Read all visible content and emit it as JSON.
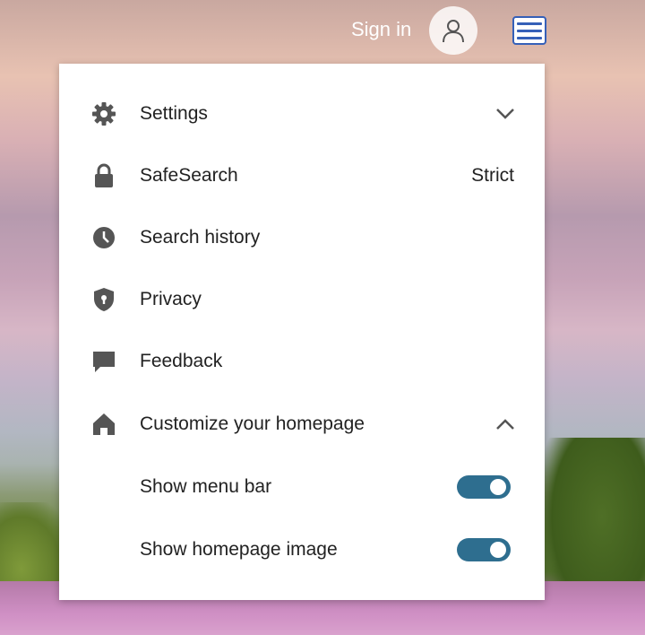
{
  "header": {
    "sign_in_label": "Sign in"
  },
  "menu": {
    "items": [
      {
        "label": "Settings",
        "icon": "gear-icon",
        "expand": "chevron-down"
      },
      {
        "label": "SafeSearch",
        "icon": "lock-icon",
        "value": "Strict"
      },
      {
        "label": "Search history",
        "icon": "clock-icon"
      },
      {
        "label": "Privacy",
        "icon": "shield-icon"
      },
      {
        "label": "Feedback",
        "icon": "speech-bubble-icon"
      },
      {
        "label": "Customize your homepage",
        "icon": "home-icon",
        "expand": "chevron-up"
      }
    ],
    "toggles": [
      {
        "label": "Show menu bar",
        "on": true
      },
      {
        "label": "Show homepage image",
        "on": true
      }
    ]
  },
  "colors": {
    "toggle_on": "#2e6e8f",
    "menu_button_accent": "#3560b8",
    "icon_gray": "#555555",
    "text": "#222222"
  }
}
